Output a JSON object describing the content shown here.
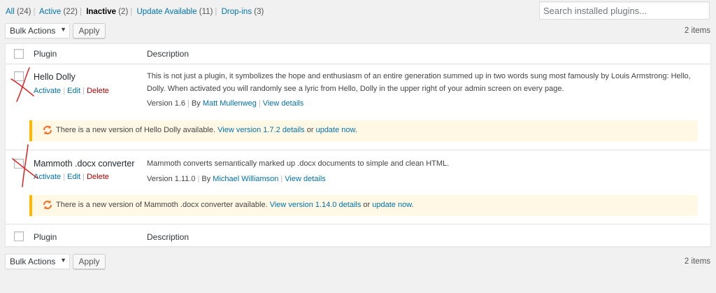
{
  "filters": [
    {
      "label": "All",
      "count": "(24)"
    },
    {
      "label": "Active",
      "count": "(22)"
    },
    {
      "label": "Inactive",
      "count": "(2)"
    },
    {
      "label": "Update Available",
      "count": "(11)"
    },
    {
      "label": "Drop-ins",
      "count": "(3)"
    }
  ],
  "filter_separator": "|",
  "search": {
    "placeholder": "Search installed plugins..."
  },
  "tablenav": {
    "bulk_actions": "Bulk Actions",
    "apply": "Apply",
    "items": "2 items"
  },
  "columns": {
    "plugin": "Plugin",
    "description": "Description"
  },
  "plugins": [
    {
      "name": "Hello Dolly",
      "actions": {
        "activate": "Activate",
        "edit": "Edit",
        "delete": "Delete",
        "separator": "|"
      },
      "description": "This is not just a plugin, it symbolizes the hope and enthusiasm of an entire generation summed up in two words sung most famously by Louis Armstrong: Hello, Dolly. When activated you will randomly see a lyric from Hello, Dolly in the upper right of your admin screen on every page.",
      "version": "Version 1.6",
      "by": "By",
      "author": "Matt Mullenweg",
      "view_details": "View details",
      "update_notice": {
        "text": "There is a new version of Hello Dolly available.",
        "view_version": "View version 1.7.2 details",
        "or": "or",
        "update_now": "update now",
        "end": "."
      }
    },
    {
      "name": "Mammoth .docx converter",
      "actions": {
        "activate": "Activate",
        "edit": "Edit",
        "delete": "Delete",
        "separator": "|"
      },
      "description": "Mammoth converts semantically marked up .docx documents to simple and clean HTML.",
      "version": "Version 1.11.0",
      "by": "By",
      "author": "Michael Williamson",
      "view_details": "View details",
      "update_notice": {
        "text": "There is a new version of Mammoth .docx converter available.",
        "view_version": "View version 1.14.0 details",
        "or": "or",
        "update_now": "update now",
        "end": "."
      }
    }
  ],
  "colors": {
    "link": "#0073aa",
    "delete": "#a00000",
    "notice_border": "#ffb900",
    "notice_bg": "#fff8e5",
    "annotation": "#e02020",
    "update_icon": "#f56e28"
  },
  "icons": {
    "update": "update-arrows-icon",
    "dropdown": "chevron-down-icon",
    "annotation": "red-x-mark"
  }
}
